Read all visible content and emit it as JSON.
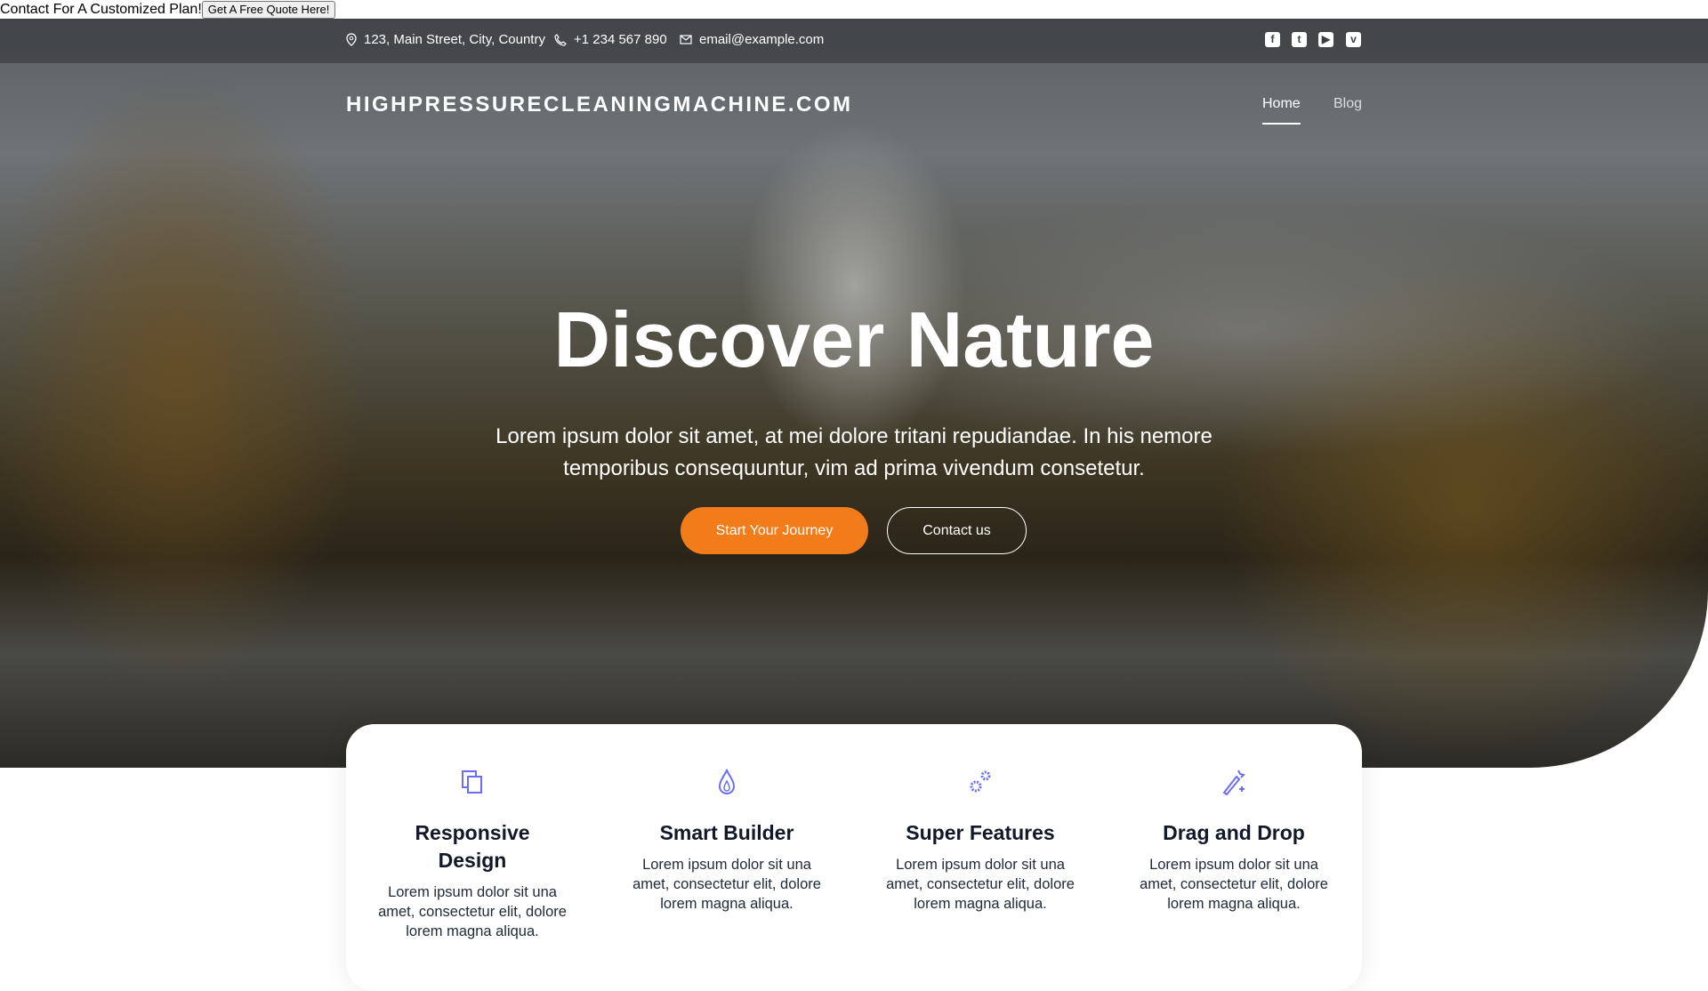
{
  "promo": {
    "text": "Contact For A Customized Plan!",
    "button": "Get A Free Quote Here!"
  },
  "contact": {
    "address": "123, Main Street, City, Country",
    "phone": "+1 234 567 890",
    "email": "email@example.com"
  },
  "social": [
    "facebook-icon",
    "twitter-icon",
    "youtube-icon",
    "vimeo-icon"
  ],
  "logo": "HIGHPRESSURECLEANINGMACHINE.COM",
  "nav": [
    {
      "label": "Home",
      "active": true
    },
    {
      "label": "Blog",
      "active": false
    }
  ],
  "hero": {
    "title": "Discover Nature",
    "subtitle": "Lorem ipsum dolor sit amet, at mei dolore tritani repudiandae. In his nemore temporibus consequuntur, vim ad prima vivendum consetetur.",
    "primary_button": "Start Your Journey",
    "secondary_button": "Contact us"
  },
  "colors": {
    "accent": "#f27b1a",
    "icon": "#6b6ef0"
  },
  "features": [
    {
      "icon": "copy-icon",
      "title": "Responsive Design",
      "text": "Lorem ipsum dolor sit una amet, consectetur elit, dolore lorem magna aliqua."
    },
    {
      "icon": "flame-icon",
      "title": "Smart Builder",
      "text": "Lorem ipsum dolor sit una amet, consectetur elit, dolore lorem magna aliqua."
    },
    {
      "icon": "gears-icon",
      "title": "Super Features",
      "text": "Lorem ipsum dolor sit una amet, consectetur elit, dolore lorem magna aliqua."
    },
    {
      "icon": "magic-wand-icon",
      "title": "Drag and Drop",
      "text": "Lorem ipsum dolor sit una amet, consectetur elit, dolore lorem magna aliqua."
    }
  ]
}
